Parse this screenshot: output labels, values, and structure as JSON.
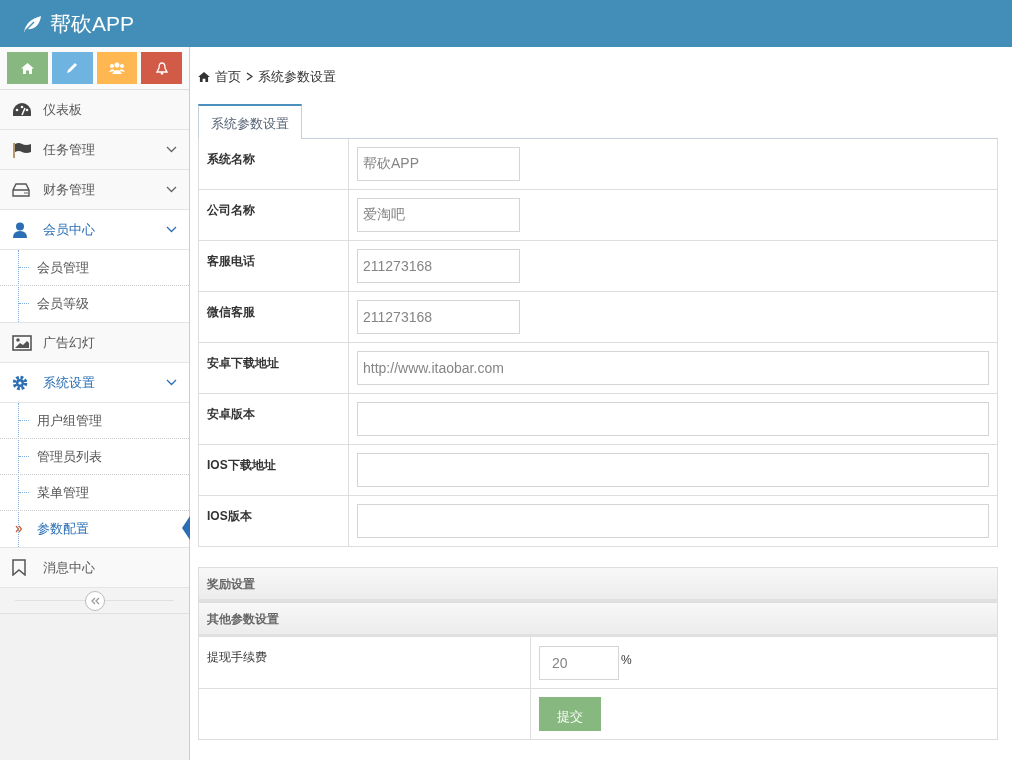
{
  "header": {
    "title": "帮砍APP"
  },
  "shortcut_buttons": [
    {
      "kind": "home",
      "color": "#87b87f"
    },
    {
      "kind": "pencil",
      "color": "#6fb3e0"
    },
    {
      "kind": "users",
      "color": "#ffb752"
    },
    {
      "kind": "bell",
      "color": "#d15b47"
    }
  ],
  "sidebar": {
    "items": [
      {
        "label": "仪表板",
        "kind": "dashboard",
        "expanded": false
      },
      {
        "label": "任务管理",
        "kind": "flag",
        "expanded": false,
        "has_caret": true
      },
      {
        "label": "财务管理",
        "kind": "drive",
        "expanded": false,
        "has_caret": true
      },
      {
        "label": "会员中心",
        "kind": "user",
        "expanded": true,
        "has_caret": true,
        "children": [
          {
            "label": "会员管理",
            "selected": false
          },
          {
            "label": "会员等级",
            "selected": false
          }
        ]
      },
      {
        "label": "广告幻灯",
        "kind": "picture",
        "expanded": false
      },
      {
        "label": "系统设置",
        "kind": "gear",
        "expanded": true,
        "has_caret": true,
        "children": [
          {
            "label": "用户组管理",
            "selected": false
          },
          {
            "label": "管理员列表",
            "selected": false
          },
          {
            "label": "菜单管理",
            "selected": false
          },
          {
            "label": "参数配置",
            "selected": true
          }
        ]
      },
      {
        "label": "消息中心",
        "kind": "bookmark",
        "expanded": false
      }
    ]
  },
  "breadcrumb": [
    "首页",
    "系统参数设置"
  ],
  "tabs": [
    {
      "label": "系统参数设置",
      "selected": true
    }
  ],
  "fields": [
    {
      "label": "系统名称",
      "kind": "short",
      "value": "帮砍APP"
    },
    {
      "label": "公司名称",
      "kind": "short",
      "value": "爱淘吧"
    },
    {
      "label": "客服电话",
      "kind": "short",
      "value": "211273168"
    },
    {
      "label": "微信客服",
      "kind": "short",
      "value": "211273168"
    },
    {
      "label": "安卓下载地址",
      "kind": "wide",
      "value": "http://www.itaobar.com"
    },
    {
      "label": "安卓版本",
      "kind": "wide"
    },
    {
      "label": "IOS下载地址",
      "kind": "wide"
    },
    {
      "label": "IOS版本",
      "kind": "wide"
    }
  ],
  "sections": [
    "奖励设置",
    "其他参数设置"
  ],
  "fee": {
    "label": "提现手续费",
    "value": "20",
    "unit": "%"
  },
  "submit": "提交"
}
